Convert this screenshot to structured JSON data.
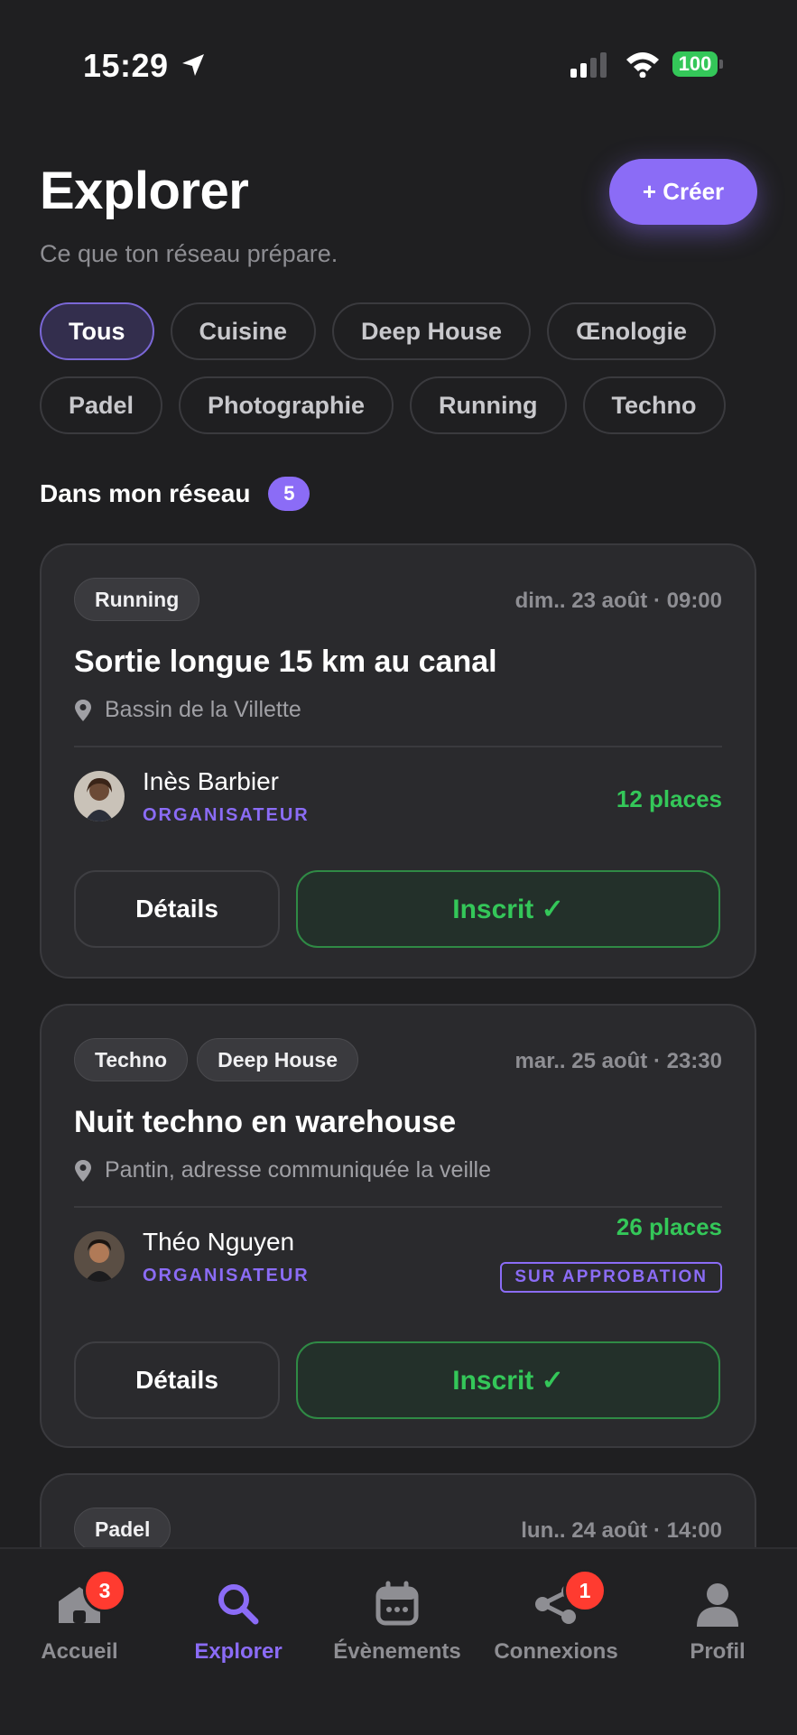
{
  "status_bar": {
    "time": "15:29",
    "battery": "100"
  },
  "header": {
    "title": "Explorer",
    "subtitle": "Ce que ton réseau prépare.",
    "create_label": "+ Créer"
  },
  "filters": {
    "row1": [
      "Tous",
      "Cuisine",
      "Deep House",
      "Œnologie"
    ],
    "row2": [
      "Padel",
      "Photographie",
      "Running",
      "Techno"
    ],
    "selected": "Tous"
  },
  "section": {
    "title": "Dans mon réseau",
    "count": "5"
  },
  "events": [
    {
      "tags": [
        "Running"
      ],
      "date": "dim.. 23 août · 09:00",
      "title": "Sortie longue 15 km au canal",
      "location": "Bassin de la Villette",
      "organizer": "Inès Barbier",
      "role": "ORGANISATEUR",
      "places": "12 places",
      "details_label": "Détails",
      "status_label": "Inscrit ✓"
    },
    {
      "tags": [
        "Techno",
        "Deep House"
      ],
      "date": "mar.. 25 août · 23:30",
      "title": "Nuit techno en warehouse",
      "location": "Pantin, adresse communiquée la veille",
      "organizer": "Théo Nguyen",
      "role": "ORGANISATEUR",
      "places": "26 places",
      "approval": "SUR APPROBATION",
      "details_label": "Détails",
      "status_label": "Inscrit ✓"
    },
    {
      "tags": [
        "Padel"
      ],
      "date": "lun.. 24 août · 14:00"
    }
  ],
  "tab_bar": {
    "tabs": [
      {
        "label": "Accueil",
        "icon": "home-icon",
        "badge": "3"
      },
      {
        "label": "Explorer",
        "icon": "search-icon",
        "active": true
      },
      {
        "label": "Évènements",
        "icon": "calendar-icon"
      },
      {
        "label": "Connexions",
        "icon": "share-icon",
        "badge": "1"
      },
      {
        "label": "Profil",
        "icon": "person-icon"
      }
    ]
  },
  "colors": {
    "accent": "#8b6cf6",
    "success": "#34c759",
    "badge": "#ff3b30",
    "background": "#1f1f21",
    "card": "#2a2a2d"
  }
}
